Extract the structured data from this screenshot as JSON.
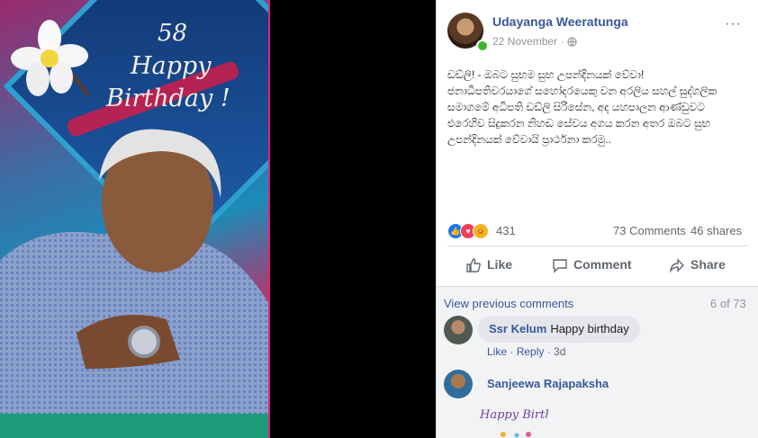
{
  "image": {
    "age_number": "58",
    "greeting_line1": "Happy",
    "greeting_line2": "Birthday !"
  },
  "post": {
    "author": "Udayanga Weeratunga",
    "date": "22 November",
    "more_label": "···",
    "text_lines": [
      "ඩඩ්ලි! - ඔබට සුභම සුභ උපන්දිනයක් වේවා!",
      "ජනාධිපතිවරයාගේ සහෝදරයෙකු වන අරලිය සහල් සුද්ගලික",
      "සමාගමේ අධිපති ඩඩ්ලි සිරිසේන, අද යහපාලන ආණ්ඩුවට",
      "එරෙහිව සිදුකරන නිහඬ සේවය අගය කරන අතර ඔබට සුභ",
      "උපන්දිනයක් වේවායි ප්‍රාර්ථනා කරමු.."
    ],
    "reaction_count": "431",
    "comments_count": "73 Comments",
    "shares_count": "46 shares",
    "actions": {
      "like": "Like",
      "comment": "Comment",
      "share": "Share"
    }
  },
  "comments": {
    "view_previous": "View previous comments",
    "page_count": "6 of 73",
    "items": [
      {
        "name": "Ssr Kelum",
        "text": "Happy birthday",
        "like": "Like",
        "reply": "Reply",
        "time": "3d"
      },
      {
        "name": "Sanjeewa Rajapaksha",
        "sticker_text": "Happy Birthday"
      }
    ]
  },
  "colors": {
    "link": "#385898",
    "online": "#42b72a",
    "accent_border": "#e0208a"
  }
}
